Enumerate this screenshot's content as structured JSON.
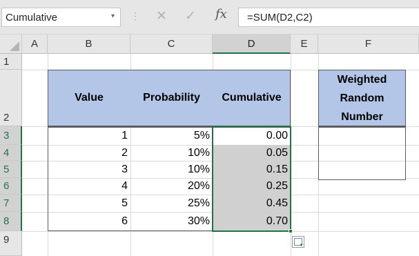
{
  "formula_bar": {
    "name_box": "Cumulative",
    "cancel_icon": "✕",
    "enter_icon": "✓",
    "function_icon": "fx",
    "formula": "=SUM(D2,C2)"
  },
  "columns": [
    "A",
    "B",
    "C",
    "D",
    "E",
    "F"
  ],
  "rows": [
    "1",
    "2",
    "3",
    "4",
    "5",
    "6",
    "7",
    "8",
    "9"
  ],
  "table": {
    "headers": [
      "Value",
      "Probability",
      "Cumulative"
    ],
    "data": [
      [
        "1",
        "5%",
        "0.00"
      ],
      [
        "2",
        "10%",
        "0.05"
      ],
      [
        "3",
        "10%",
        "0.15"
      ],
      [
        "4",
        "20%",
        "0.25"
      ],
      [
        "5",
        "25%",
        "0.45"
      ],
      [
        "6",
        "30%",
        "0.70"
      ]
    ]
  },
  "weighted": {
    "header_lines": [
      "Weighted",
      "Random",
      "Number"
    ]
  },
  "colors": {
    "header_fill": "#b4c6e7",
    "selected_fill": "#d0d0d0",
    "selection_border": "#217346"
  }
}
